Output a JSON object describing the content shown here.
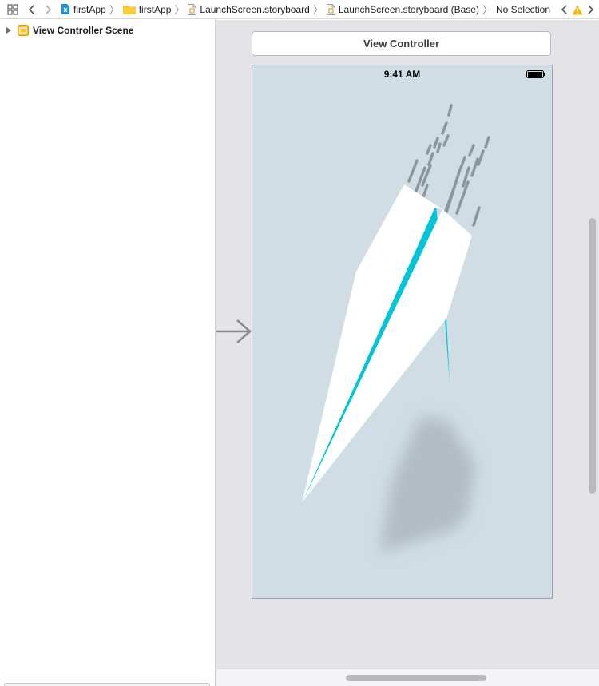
{
  "jump_bar": {
    "crumbs": [
      {
        "label": "firstApp",
        "icon": "project-icon"
      },
      {
        "label": "firstApp",
        "icon": "folder-icon"
      },
      {
        "label": "LaunchScreen.storyboard",
        "icon": "storyboard-file-icon"
      },
      {
        "label": "LaunchScreen.storyboard (Base)",
        "icon": "storyboard-file-icon"
      },
      {
        "label": "No Selection",
        "icon": ""
      }
    ],
    "separator": "〉"
  },
  "outline": {
    "scene_label": "View Controller Scene"
  },
  "canvas": {
    "scene_title": "View Controller",
    "status_time": "9:41 AM",
    "background_color": "#d0dde4",
    "accent_color": "#00c4d8",
    "warning_color": "#f5b800"
  }
}
